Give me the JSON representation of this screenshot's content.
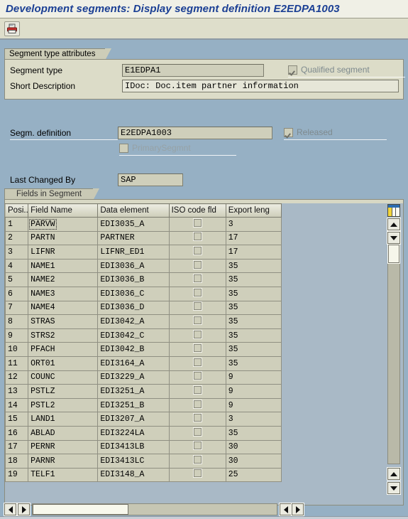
{
  "window": {
    "title": "Development segments: Display segment definition E2EDPA1003"
  },
  "toolbar": {
    "buttons": [
      {
        "name": "print-preview-icon",
        "label": ""
      }
    ]
  },
  "segment_type_attributes": {
    "group_label": "Segment type attributes",
    "segment_type": {
      "label": "Segment type",
      "value": "E1EDPA1"
    },
    "short_description": {
      "label": "Short Description",
      "value": "IDoc: Doc.item partner information"
    },
    "qualified_segment": {
      "label": "Qualified segment",
      "checked": true,
      "enabled": false
    }
  },
  "definition": {
    "segm_definition": {
      "label": "Segm. definition",
      "value": "E2EDPA1003"
    },
    "released": {
      "label": "Released",
      "checked": true,
      "enabled": false
    },
    "primary_segment": {
      "label": "PrimarySegmnt",
      "checked": false,
      "enabled": false
    },
    "last_changed_by": {
      "label": "Last Changed By",
      "value": "SAP"
    }
  },
  "fields_in_segment": {
    "group_label": "Fields in Segment",
    "columns": [
      "Posi..",
      "Field Name",
      "Data element",
      "ISO code fld",
      "Export leng"
    ],
    "rows": [
      {
        "pos": "1",
        "field": "PARVW",
        "element": "EDI3035_A",
        "iso": false,
        "len": "3"
      },
      {
        "pos": "2",
        "field": "PARTN",
        "element": "PARTNER",
        "iso": false,
        "len": "17"
      },
      {
        "pos": "3",
        "field": "LIFNR",
        "element": "LIFNR_ED1",
        "iso": false,
        "len": "17"
      },
      {
        "pos": "4",
        "field": "NAME1",
        "element": "EDI3036_A",
        "iso": false,
        "len": "35"
      },
      {
        "pos": "5",
        "field": "NAME2",
        "element": "EDI3036_B",
        "iso": false,
        "len": "35"
      },
      {
        "pos": "6",
        "field": "NAME3",
        "element": "EDI3036_C",
        "iso": false,
        "len": "35"
      },
      {
        "pos": "7",
        "field": "NAME4",
        "element": "EDI3036_D",
        "iso": false,
        "len": "35"
      },
      {
        "pos": "8",
        "field": "STRAS",
        "element": "EDI3042_A",
        "iso": false,
        "len": "35"
      },
      {
        "pos": "9",
        "field": "STRS2",
        "element": "EDI3042_C",
        "iso": false,
        "len": "35"
      },
      {
        "pos": "10",
        "field": "PFACH",
        "element": "EDI3042_B",
        "iso": false,
        "len": "35"
      },
      {
        "pos": "11",
        "field": "ORT01",
        "element": "EDI3164_A",
        "iso": false,
        "len": "35"
      },
      {
        "pos": "12",
        "field": "COUNC",
        "element": "EDI3229_A",
        "iso": false,
        "len": "9"
      },
      {
        "pos": "13",
        "field": "PSTLZ",
        "element": "EDI3251_A",
        "iso": false,
        "len": "9"
      },
      {
        "pos": "14",
        "field": "PSTL2",
        "element": "EDI3251_B",
        "iso": false,
        "len": "9"
      },
      {
        "pos": "15",
        "field": "LAND1",
        "element": "EDI3207_A",
        "iso": false,
        "len": "3"
      },
      {
        "pos": "16",
        "field": "ABLAD",
        "element": "EDI3224LA",
        "iso": false,
        "len": "35"
      },
      {
        "pos": "17",
        "field": "PERNR",
        "element": "EDI3413LB",
        "iso": false,
        "len": "30"
      },
      {
        "pos": "18",
        "field": "PARNR",
        "element": "EDI3413LC",
        "iso": false,
        "len": "30"
      },
      {
        "pos": "19",
        "field": "TELF1",
        "element": "EDI3148_A",
        "iso": false,
        "len": "25"
      }
    ],
    "focused_cell": {
      "row": 1,
      "column": "Field Name",
      "value": "PARVW"
    }
  },
  "scrollbars": {
    "table_vertical": {
      "up": "▲",
      "down": "▼"
    },
    "pane_vertical": {
      "up": "▲",
      "down": "▼"
    },
    "table_horizontal": {
      "left": "◀",
      "right": "▶"
    },
    "pane_horizontal": {
      "left": "◀",
      "right": "▶"
    },
    "config_icon": "column-config-icon"
  },
  "colors": {
    "background": "#96b0c4",
    "title_text": "#1b3f94",
    "group_bg": "#dcdcc8",
    "field_bg": "#cfcfbb",
    "accent_blue": "#2b6cb0",
    "accent_yellow": "#f2d43a"
  }
}
